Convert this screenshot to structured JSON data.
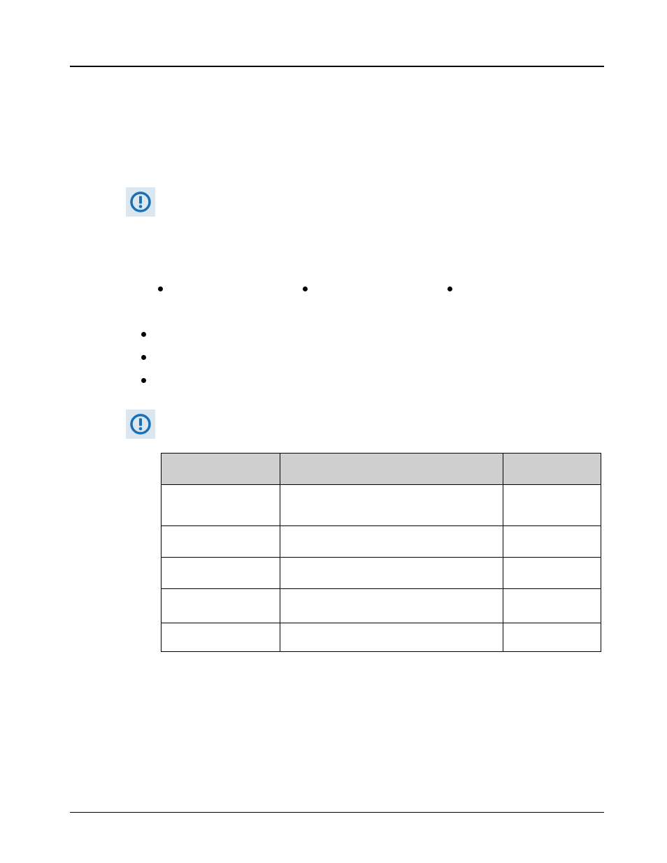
{
  "header": {
    "title": ""
  },
  "notices": {
    "one": {
      "text": ""
    },
    "two": {
      "text": ""
    }
  },
  "horizBullets": [
    {
      "label": ""
    },
    {
      "label": ""
    },
    {
      "label": ""
    }
  ],
  "vertBullets": [
    {
      "label": ""
    },
    {
      "label": ""
    },
    {
      "label": ""
    }
  ],
  "table": {
    "headers": {
      "c1": "",
      "c2": "",
      "c3": ""
    },
    "rows": [
      {
        "c1": "",
        "c2": "",
        "c3": ""
      },
      {
        "c1": "",
        "c2": "",
        "c3": ""
      },
      {
        "c1": "",
        "c2": "",
        "c3": ""
      },
      {
        "c1": "",
        "c2": "",
        "c3": ""
      },
      {
        "c1": "",
        "c2": "",
        "c3": ""
      }
    ]
  },
  "footer": {
    "left": "",
    "right": ""
  }
}
